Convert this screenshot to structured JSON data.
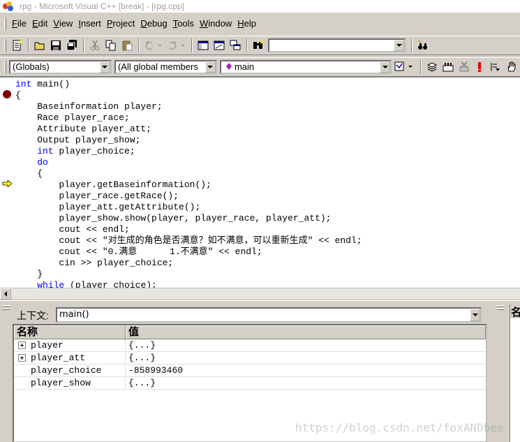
{
  "window": {
    "title": "rpg - Microsoft Visual C++ [break] - [rpg.cpp]"
  },
  "menu": [
    "File",
    "Edit",
    "View",
    "Insert",
    "Project",
    "Debug",
    "Tools",
    "Window",
    "Help"
  ],
  "menu_mnemonics": [
    "F",
    "E",
    "V",
    "I",
    "P",
    "D",
    "T",
    "W",
    "H"
  ],
  "toolbar": {
    "find_combo_value": "",
    "scope_combo": "(Globals)",
    "members_combo": "(All global members",
    "function_combo": "main"
  },
  "editor": {
    "breakpoint_line": 1,
    "current_line": 9,
    "lines": [
      [
        [
          "kw",
          "int"
        ],
        [
          "t",
          " main()"
        ]
      ],
      [
        [
          "t",
          "{"
        ]
      ],
      [
        [
          "t",
          "    Baseinformation player;"
        ]
      ],
      [
        [
          "t",
          "    Race player_race;"
        ]
      ],
      [
        [
          "t",
          "    Attribute player_att;"
        ]
      ],
      [
        [
          "t",
          "    Output player_show;"
        ]
      ],
      [
        [
          "t",
          "    "
        ],
        [
          "kw",
          "int"
        ],
        [
          "t",
          " player_choice;"
        ]
      ],
      [
        [
          "t",
          "    "
        ],
        [
          "kw",
          "do"
        ]
      ],
      [
        [
          "t",
          "    {"
        ]
      ],
      [
        [
          "t",
          "        player.getBaseinformation();"
        ]
      ],
      [
        [
          "t",
          "        player_race.getRace();"
        ]
      ],
      [
        [
          "t",
          "        player_att.getAttribute();"
        ]
      ],
      [
        [
          "t",
          "        player_show.show(player, player_race, player_att);"
        ]
      ],
      [
        [
          "t",
          "        cout << endl;"
        ]
      ],
      [
        [
          "t",
          "        cout << \"对生成的角色是否满意？如不满意，可以重新生成\" << endl;"
        ]
      ],
      [
        [
          "t",
          "        cout << \"0.满意      1.不满意\" << endl;"
        ]
      ],
      [
        [
          "t",
          "        cin >> player_choice;"
        ]
      ],
      [
        [
          "t",
          "    }"
        ]
      ],
      [
        [
          "t",
          "    "
        ],
        [
          "kw",
          "while"
        ],
        [
          "t",
          " (player_choice);"
        ]
      ]
    ]
  },
  "variables": {
    "context_label": "上下文:",
    "context_value": "main()",
    "col_name": "名称",
    "col_value": "值",
    "rows": [
      {
        "name": "player",
        "value": "{...}",
        "expandable": true
      },
      {
        "name": "player_att",
        "value": "{...}",
        "expandable": true
      },
      {
        "name": "player_choice",
        "value": "-858993460",
        "expandable": false
      },
      {
        "name": "player_show",
        "value": "{...}",
        "expandable": false
      }
    ]
  },
  "watch": {
    "col_name": "名"
  },
  "watermark": "https://blog.csdn.net/foxANDbee"
}
